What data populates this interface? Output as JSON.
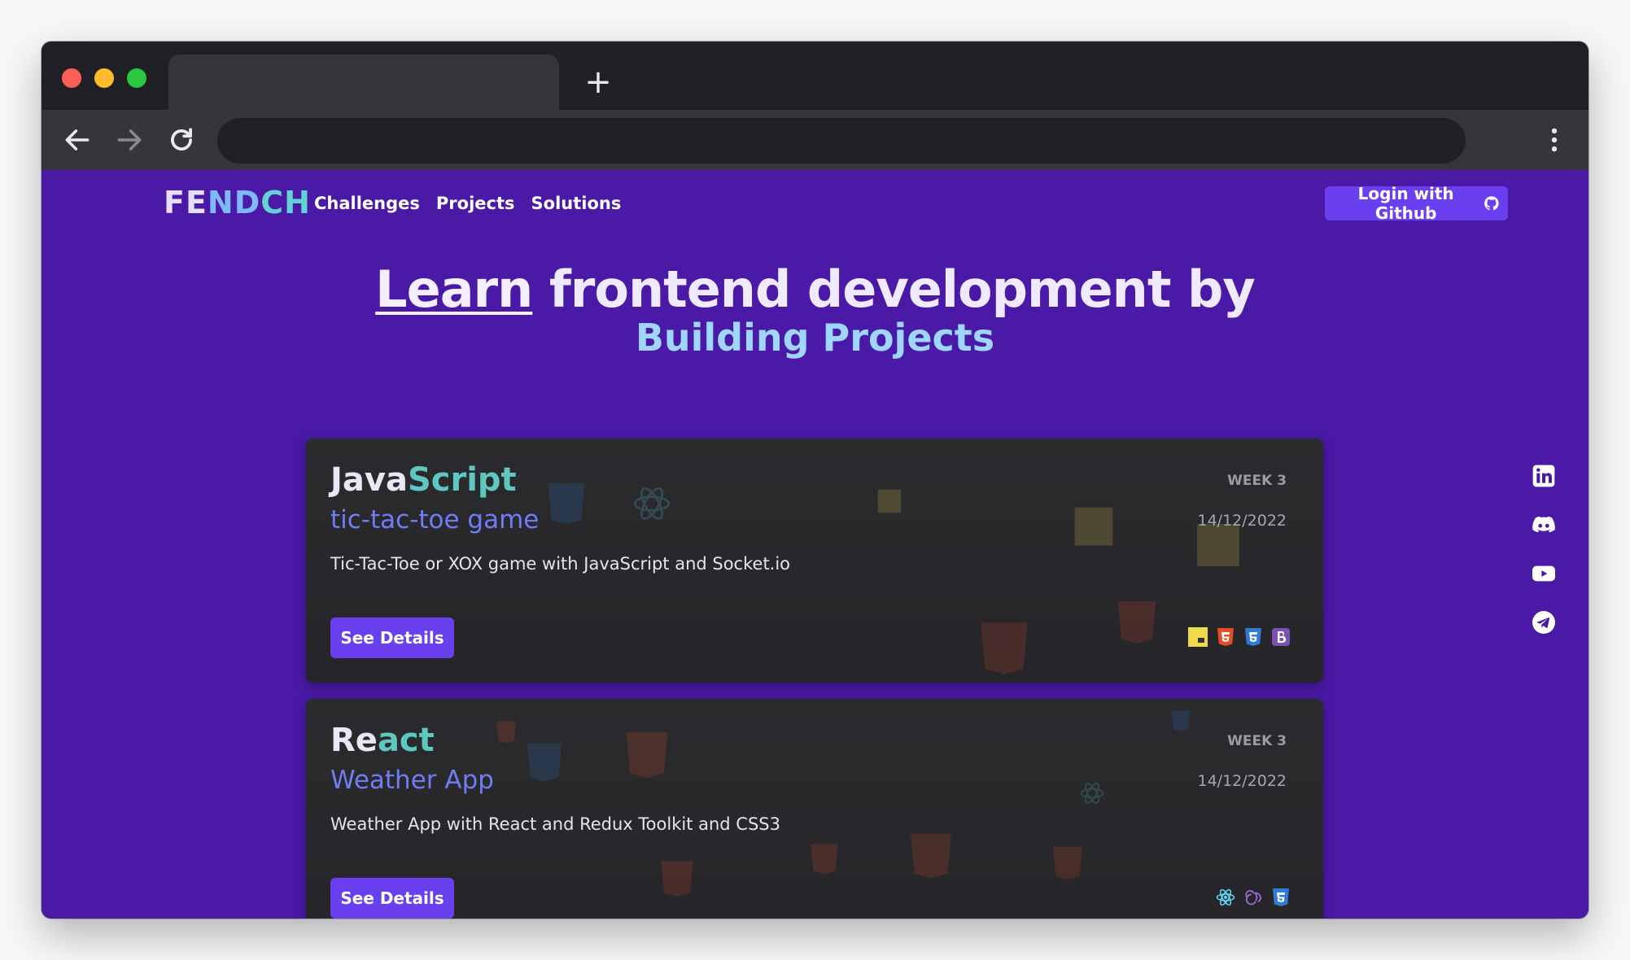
{
  "browser": {
    "new_tab_icon": "plus-icon",
    "back_icon": "arrow-left-icon",
    "forward_icon": "arrow-right-icon",
    "reload_icon": "reload-icon",
    "menu_icon": "kebab-menu-icon"
  },
  "header": {
    "logo_parts": [
      "FE",
      "ND",
      "CH"
    ],
    "nav": [
      "Challenges",
      "Projects",
      "Solutions"
    ],
    "login_label": "Login with Github",
    "login_icon": "github-icon"
  },
  "hero": {
    "emphasis": "Learn",
    "line1_rest": " frontend development by",
    "line2": "Building Projects"
  },
  "cards": [
    {
      "tech_a": "Java",
      "tech_b": "Script",
      "title": "tic-tac-toe game",
      "description": "Tic-Tac-Toe or XOX game with JavaScript and Socket.io",
      "week": "WEEK 3",
      "date": "14/12/2022",
      "button": "See Details",
      "tech_icons": [
        "javascript-icon",
        "html5-icon",
        "css3-icon",
        "bootstrap-icon"
      ]
    },
    {
      "tech_a": "Re",
      "tech_b": "act",
      "title": "Weather App",
      "description": "Weather App with React and Redux Toolkit and CSS3",
      "week": "WEEK 3",
      "date": "14/12/2022",
      "button": "See Details",
      "tech_icons": [
        "react-icon",
        "redux-icon",
        "css3-icon"
      ]
    }
  ],
  "social": [
    "linkedin-icon",
    "discord-icon",
    "youtube-icon",
    "telegram-icon"
  ],
  "colors": {
    "page_bg": "#4a1aa6",
    "accent": "#6a3ff0",
    "card_bg": "#2b2b2e",
    "title_blue": "#6f7df5",
    "teal": "#5ec7c0"
  }
}
